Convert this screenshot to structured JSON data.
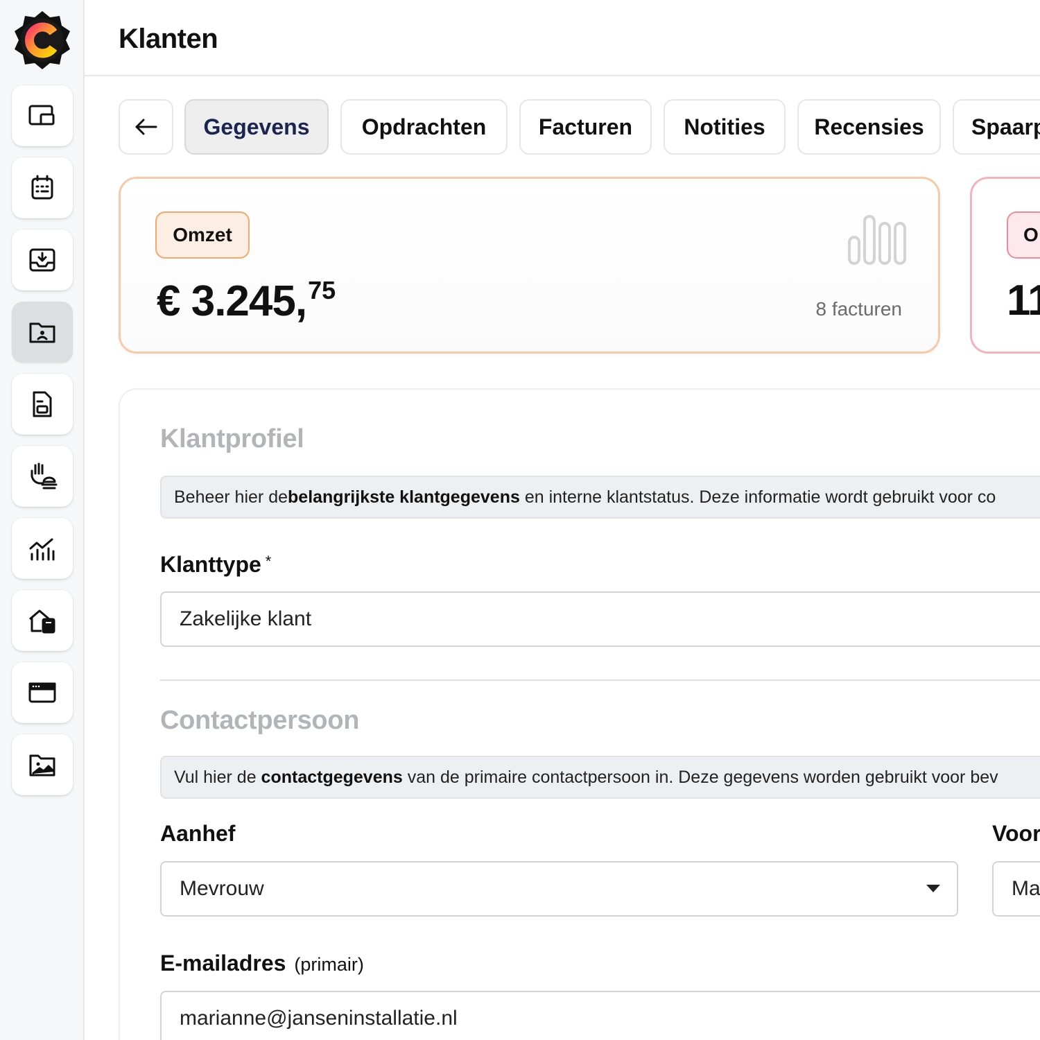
{
  "app": {
    "logo_icon": "c-badge-logo",
    "nav_items": [
      {
        "name": "dashboard",
        "icon": "windows-icon"
      },
      {
        "name": "planning",
        "icon": "calendar-icon"
      },
      {
        "name": "inbox",
        "icon": "inbox-download-icon"
      },
      {
        "name": "klanten",
        "icon": "contact-folder-icon",
        "active": true
      },
      {
        "name": "documenten",
        "icon": "document-icon"
      },
      {
        "name": "diensten",
        "icon": "hand-service-icon"
      },
      {
        "name": "rapportage",
        "icon": "chart-icon"
      },
      {
        "name": "vestigingen",
        "icon": "building-calculator-icon"
      },
      {
        "name": "website",
        "icon": "browser-window-icon"
      },
      {
        "name": "media",
        "icon": "image-folder-icon"
      }
    ]
  },
  "header": {
    "title": "Klanten"
  },
  "tabs": [
    {
      "label": "Gegevens",
      "active": true
    },
    {
      "label": "Opdrachten"
    },
    {
      "label": "Facturen"
    },
    {
      "label": "Notities"
    },
    {
      "label": "Recensies"
    },
    {
      "label": "Spaarp"
    }
  ],
  "stats": {
    "omzet": {
      "badge": "Omzet",
      "currency": "€",
      "amount_main": "3.245,",
      "amount_cents": "75",
      "count_label": "8 facturen",
      "accent_color": "#f4a86a"
    },
    "second": {
      "badge": "O",
      "value": "11",
      "accent_color": "#ef8a9a"
    }
  },
  "form": {
    "klantprofiel": {
      "title": "Klantprofiel",
      "info_pre": "Beheer hier de ",
      "info_bold": "belangrijkste klantgegevens",
      "info_post": " en interne klantstatus. Deze informatie wordt gebruikt voor co"
    },
    "klanttype": {
      "label": "Klanttype",
      "required_mark": "*",
      "value": "Zakelijke klant"
    },
    "contactpersoon": {
      "title": "Contactpersoon",
      "info_pre": "Vul hier de ",
      "info_bold": "contactgegevens",
      "info_post": " van de primaire contactpersoon in. Deze gegevens worden gebruikt voor bev"
    },
    "aanhef": {
      "label": "Aanhef",
      "value": "Mevrouw"
    },
    "voornaam": {
      "label": "Voor",
      "value": "Ma"
    },
    "email": {
      "label": "E-mailadres",
      "hint": "(primair)",
      "value": "marianne@janseninstallatie.nl"
    }
  }
}
